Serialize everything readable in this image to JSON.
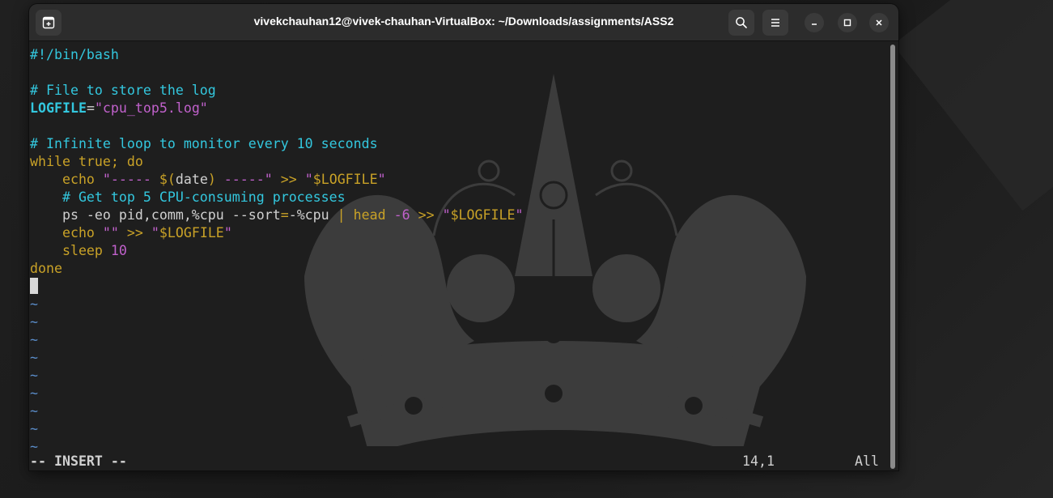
{
  "window": {
    "title": "vivekchauhan12@vivek-chauhan-VirtualBox: ~/Downloads/assignments/ASS2"
  },
  "icons": {
    "new_tab": "new-tab-icon",
    "search": "search-icon",
    "menu": "hamburger-menu-icon",
    "minimize": "minimize-icon",
    "maximize": "maximize-icon",
    "close": "close-icon"
  },
  "editor": {
    "lines": [
      [
        {
          "t": "#!/bin/bash",
          "c": "c-comment"
        }
      ],
      [],
      [
        {
          "t": "# File to store the log",
          "c": "c-comment"
        }
      ],
      [
        {
          "t": "LOGFILE",
          "c": "c-var"
        },
        {
          "t": "=",
          "c": "c-plain"
        },
        {
          "t": "\"cpu_top5.log\"",
          "c": "c-str"
        }
      ],
      [],
      [
        {
          "t": "# Infinite loop to monitor every 10 seconds",
          "c": "c-comment"
        }
      ],
      [
        {
          "t": "while true; do",
          "c": "c-kw"
        }
      ],
      [
        {
          "t": "    echo ",
          "c": "c-kw"
        },
        {
          "t": "\"----- ",
          "c": "c-str"
        },
        {
          "t": "$(",
          "c": "c-kw"
        },
        {
          "t": "date",
          "c": "c-plain"
        },
        {
          "t": ")",
          "c": "c-kw"
        },
        {
          "t": " -----\"",
          "c": "c-str"
        },
        {
          "t": " >> ",
          "c": "c-kw"
        },
        {
          "t": "\"",
          "c": "c-str"
        },
        {
          "t": "$LOGFILE",
          "c": "c-kw"
        },
        {
          "t": "\"",
          "c": "c-str"
        }
      ],
      [
        {
          "t": "    # Get top 5 CPU-consuming processes",
          "c": "c-comment"
        }
      ],
      [
        {
          "t": "    ps -eo pid,comm,%cpu --sort",
          "c": "c-plain"
        },
        {
          "t": "=",
          "c": "c-op"
        },
        {
          "t": "-%cpu ",
          "c": "c-plain"
        },
        {
          "t": "|",
          "c": "c-op"
        },
        {
          "t": " head ",
          "c": "c-kw"
        },
        {
          "t": "-6",
          "c": "c-num"
        },
        {
          "t": " >> ",
          "c": "c-kw"
        },
        {
          "t": "\"",
          "c": "c-str"
        },
        {
          "t": "$LOGFILE",
          "c": "c-kw"
        },
        {
          "t": "\"",
          "c": "c-str"
        }
      ],
      [
        {
          "t": "    echo ",
          "c": "c-kw"
        },
        {
          "t": "\"\"",
          "c": "c-str"
        },
        {
          "t": " >> ",
          "c": "c-kw"
        },
        {
          "t": "\"",
          "c": "c-str"
        },
        {
          "t": "$LOGFILE",
          "c": "c-kw"
        },
        {
          "t": "\"",
          "c": "c-str"
        }
      ],
      [
        {
          "t": "    sleep ",
          "c": "c-kw"
        },
        {
          "t": "10",
          "c": "c-num"
        }
      ],
      [
        {
          "t": "done",
          "c": "c-kw"
        }
      ]
    ],
    "empty_line_marker": "~",
    "empty_line_count": 9
  },
  "status": {
    "mode": "-- INSERT --",
    "position": "14,1",
    "scroll": "All"
  },
  "colors": {
    "comment": "#33c7de",
    "string": "#c061cb",
    "keyword": "#c9a227",
    "tilde": "#5b8ecb",
    "background": "#1e1e1e"
  }
}
